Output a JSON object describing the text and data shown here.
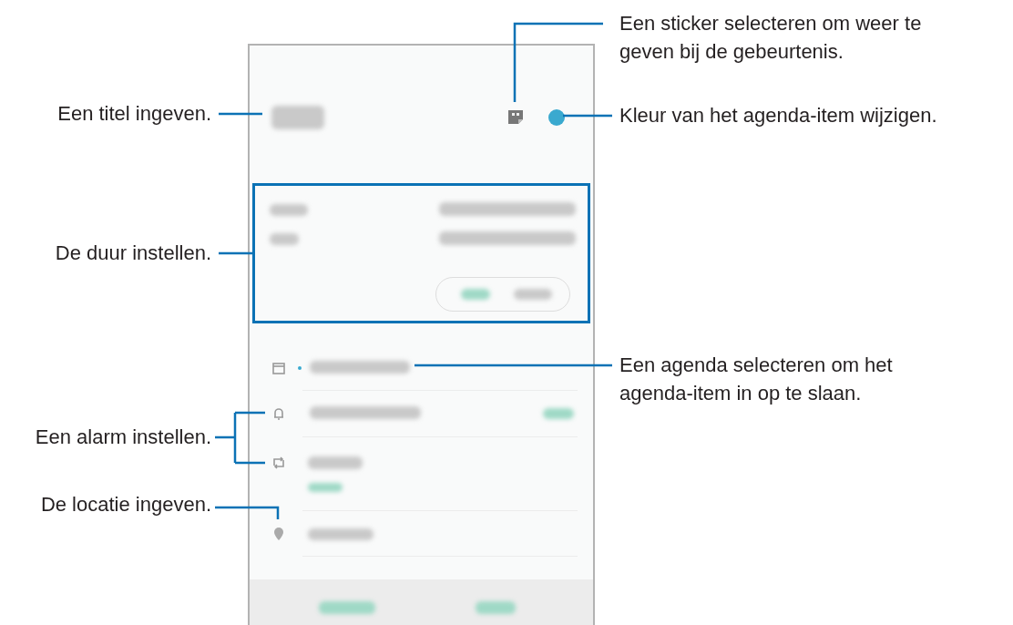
{
  "callouts_left": [
    {
      "text": "Een titel ingeven."
    },
    {
      "text": "De duur instellen."
    },
    {
      "text": "Een alarm instellen."
    },
    {
      "text": "De locatie ingeven."
    }
  ],
  "callouts_right": [
    {
      "text": "Een sticker selecteren om weer te geven bij de gebeurtenis."
    },
    {
      "text": "Kleur van het agenda-item wijzigen."
    },
    {
      "text": "Een agenda selecteren om het agenda-item in op te slaan."
    }
  ]
}
